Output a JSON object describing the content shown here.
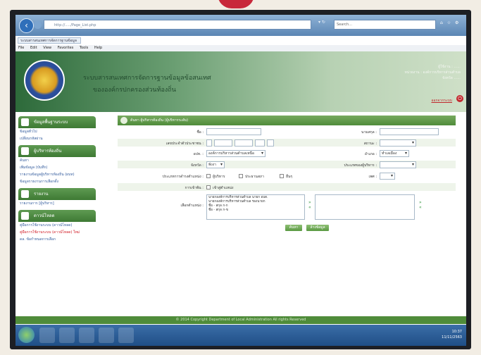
{
  "browser": {
    "address": "http://...../Page_List.php",
    "search_label": "Search...",
    "tab_title": "ระบบสารสนเทศการจัดการฐานข้อมูล",
    "menu": [
      "File",
      "Edit",
      "View",
      "Favorites",
      "Tools",
      "Help"
    ]
  },
  "header": {
    "title_line1": "ระบบสารสนเทศการจัดการฐานข้อมูลข้อสนเทศ",
    "title_line2": "ขององค์กรปกครองส่วนท้องถิ่น",
    "user_info": [
      "ผู้ใช้งาน : ......",
      "หน่วยงาน : องค์การบริหารส่วนตำบล",
      "จังหวัด ......"
    ],
    "logout_label": "ออกจากระบบ"
  },
  "sidebar": {
    "sections": [
      {
        "title": "ข้อมูลพื้นฐานระบบ",
        "items": [
          "ข้อมูลทั่วไป",
          "เปลี่ยนรหัสผ่าน"
        ]
      },
      {
        "title": "ผู้บริหารท้องถิ่น",
        "items": [
          "ค้นหา",
          "เพิ่มข้อมูล (บันทึก)",
          "รายงานข้อมูลผู้บริหารท้องถิ่น (ผบท)",
          "ข้อมูลรายงานการเลือกตั้ง"
        ]
      },
      {
        "title": "รายงาน",
        "items": [
          "รายงานการ [ผู้บริหาร]"
        ]
      },
      {
        "title": "ดาวน์โหลด",
        "items": [
          "คู่มือการใช้งานระบบ (ดาวน์โหลด)",
          "คู่มือการใช้งานระบบ (ดาวน์โหลด) ใหม่",
          "ดล. ข้อกำหนดการเลือก"
        ]
      }
    ]
  },
  "form": {
    "panel_title": "ค้นหา ผู้บริหารท้องถิ่น (ผู้บริหารระดับ)",
    "name_label": "ชื่อ :",
    "surname_label": "นามสกุล :",
    "idcard_label": "เลขประจำตัวประชาชน :",
    "status_label": "สถานะ :",
    "org_label": "อปท. :",
    "org_value": "องค์การบริหารส่วนตำบลเหนือ",
    "district_label": "อำเภอ :",
    "district_value": "ทำเลเมือง",
    "province_label": "จังหวัด :",
    "province_value": "พังงา",
    "position_label": "ประเภทการดำรงตำแหน่ง :",
    "type_label": "ประเภทของผู้บริหาร :",
    "checkbox_options": [
      "ผู้บริหาร",
      "ประธานสภา",
      "อื่นๆ"
    ],
    "gender_label": "เพศ :",
    "reason_label": "การเข้าพ้น :",
    "reason_checkbox": "เข้าสู่ตำแหน่ง",
    "position_list_label": "เลือกตำแหน่ง :",
    "position_options": [
      "นายกองค์การบริหารส่วนตำบล นายก อบต.",
      "นายกองค์การบริหารส่วนตำบล รองนายก",
      "ชื่อ - สกุล ก-ก",
      "ชื่อ - สกุล ก-ข"
    ],
    "search_button": "ค้นหา",
    "reset_button": "ล้างข้อมูล"
  },
  "footer": {
    "text": "© 2014 Copyright Department of Local Administration All rights Reserved"
  },
  "taskbar": {
    "time": "10:37",
    "date": "11/11/2563"
  }
}
